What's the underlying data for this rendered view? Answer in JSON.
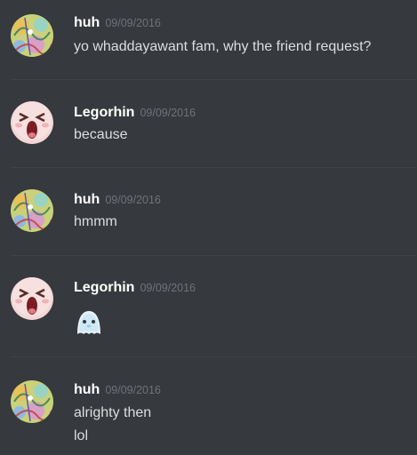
{
  "messages": [
    {
      "author": "huh",
      "timestamp": "09/09/2016",
      "avatar": "colorful-doodle-avatar",
      "lines": [
        "yo whaddayawant fam, why the friend request?"
      ]
    },
    {
      "author": "Legorhin",
      "timestamp": "09/09/2016",
      "avatar": "crying-face-avatar",
      "lines": [
        "because"
      ]
    },
    {
      "author": "huh",
      "timestamp": "09/09/2016",
      "avatar": "colorful-doodle-avatar",
      "lines": [
        "hmmm"
      ]
    },
    {
      "author": "Legorhin",
      "timestamp": "09/09/2016",
      "avatar": "crying-face-avatar",
      "emoji": "blue-blob-emoji"
    },
    {
      "author": "huh",
      "timestamp": "09/09/2016",
      "avatar": "colorful-doodle-avatar",
      "lines": [
        "alrighty then",
        "lol"
      ]
    }
  ],
  "colors": {
    "background": "#36393e",
    "divider": "#3f4247",
    "username": "#ffffff",
    "timestamp": "#6f7378",
    "message_text": "#dcddde"
  }
}
